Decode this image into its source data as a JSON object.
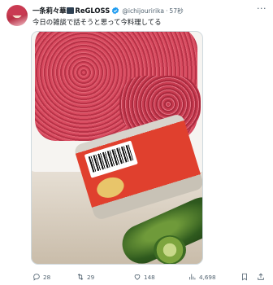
{
  "post": {
    "display_name": "一条莉々華",
    "display_name_brand": "ReGLOSS",
    "handle": "@ichijouririka",
    "separator": "·",
    "time": "57秒",
    "text": "今日の雑談で話そうと思って今料理してる",
    "more": "···"
  },
  "actions": {
    "reply_count": "28",
    "repost_count": "29",
    "like_count": "148",
    "view_count": "4,698"
  },
  "icons": {
    "verified": "verified-badge-icon",
    "reply": "reply-icon",
    "repost": "repost-icon",
    "like": "heart-icon",
    "views": "views-icon",
    "bookmark": "bookmark-icon",
    "share": "share-icon",
    "more": "more-icon"
  },
  "colors": {
    "text": "#0f1419",
    "muted": "#536471",
    "verified": "#1d9bf0",
    "border": "#cfd9de"
  }
}
